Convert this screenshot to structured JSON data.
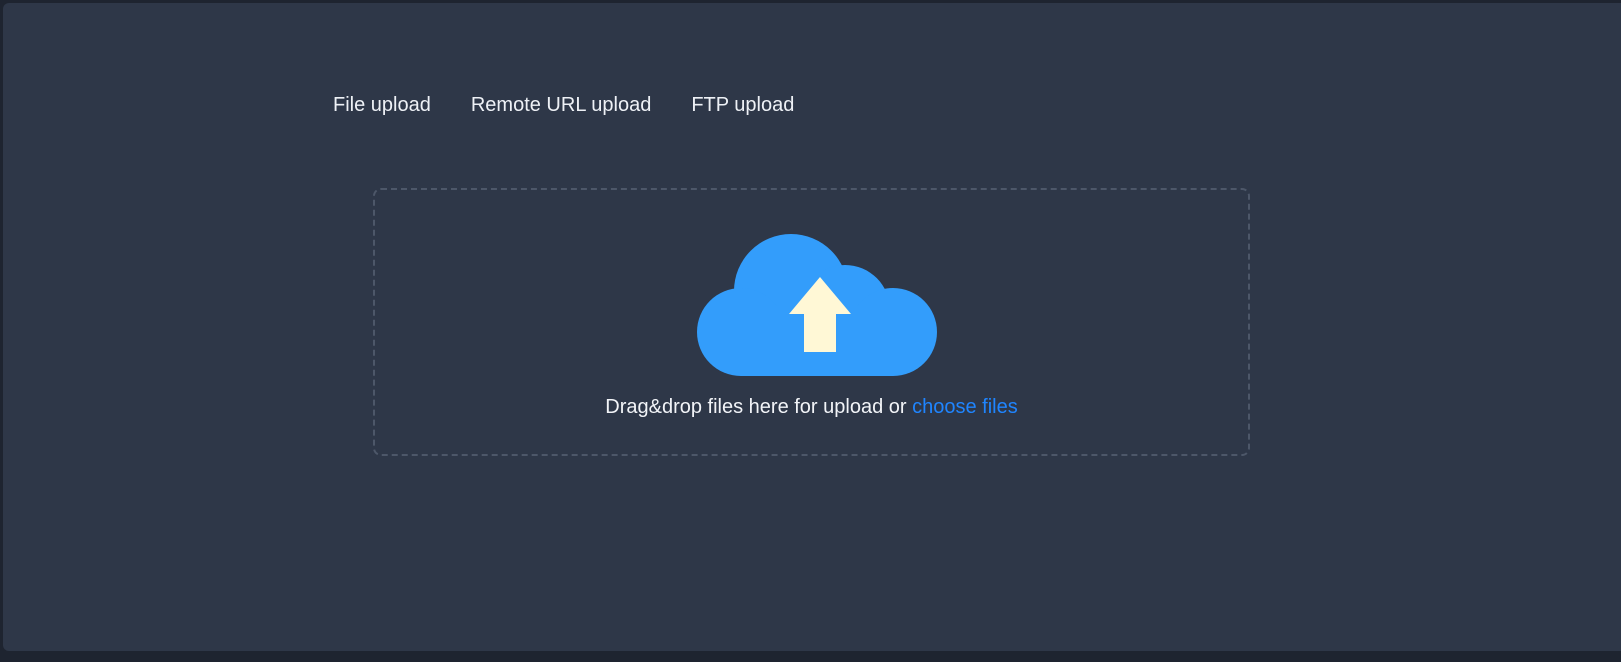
{
  "tabs": [
    {
      "label": "File upload"
    },
    {
      "label": "Remote URL upload"
    },
    {
      "label": "FTP upload"
    }
  ],
  "dropzone": {
    "icon": "cloud-upload-icon",
    "text": "Drag&drop files here for upload or",
    "link_label": "choose files"
  },
  "colors": {
    "background": "#2e3748",
    "cloud": "#339dfb",
    "arrow": "#fff8d6",
    "link": "#1f85ff",
    "text": "#eef1f6"
  }
}
